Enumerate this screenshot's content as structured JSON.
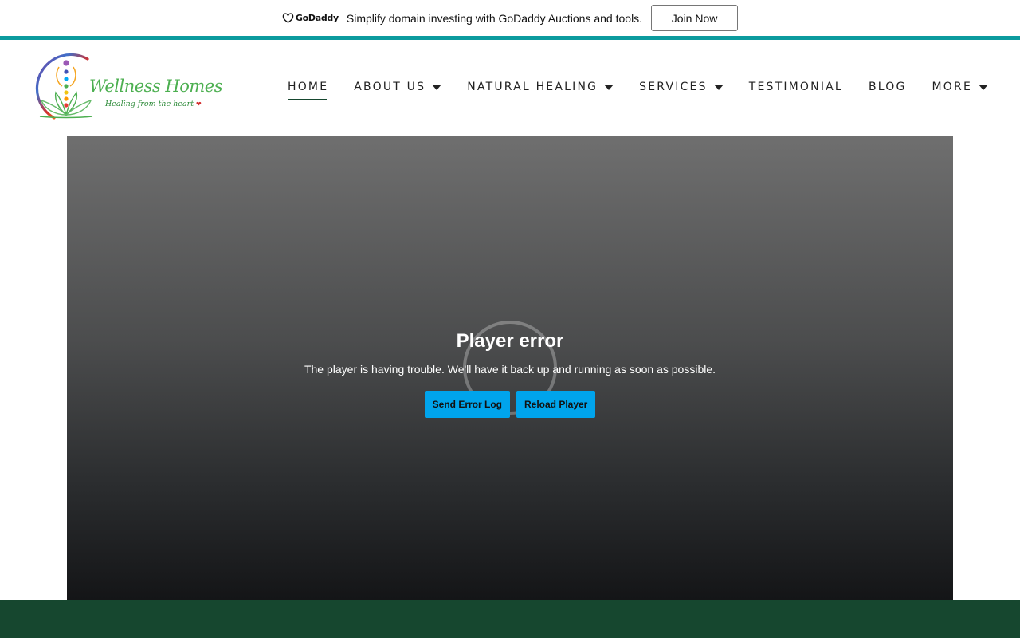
{
  "promo": {
    "brand": "GoDaddy",
    "text": "Simplify domain investing with GoDaddy Auctions and tools.",
    "cta_label": "Join Now"
  },
  "site": {
    "logo_name": "Wellness Homes",
    "logo_tagline": "Healing from the heart"
  },
  "nav": {
    "items": [
      {
        "label": "HOME",
        "active": true,
        "dropdown": false
      },
      {
        "label": "ABOUT US",
        "active": false,
        "dropdown": true
      },
      {
        "label": "NATURAL HEALING",
        "active": false,
        "dropdown": true
      },
      {
        "label": "SERVICES",
        "active": false,
        "dropdown": true
      },
      {
        "label": "TESTIMONIAL",
        "active": false,
        "dropdown": false
      },
      {
        "label": "BLOG",
        "active": false,
        "dropdown": false
      },
      {
        "label": "MORE",
        "active": false,
        "dropdown": true
      }
    ]
  },
  "player": {
    "error_title": "Player error",
    "error_message": "The player is having trouble. We'll have it back up and running as soon as possible.",
    "send_log_label": "Send Error Log",
    "reload_label": "Reload Player"
  },
  "colors": {
    "accent_teal": "#0c9b9e",
    "brand_green": "#16472f",
    "player_button": "#00a4ec"
  }
}
